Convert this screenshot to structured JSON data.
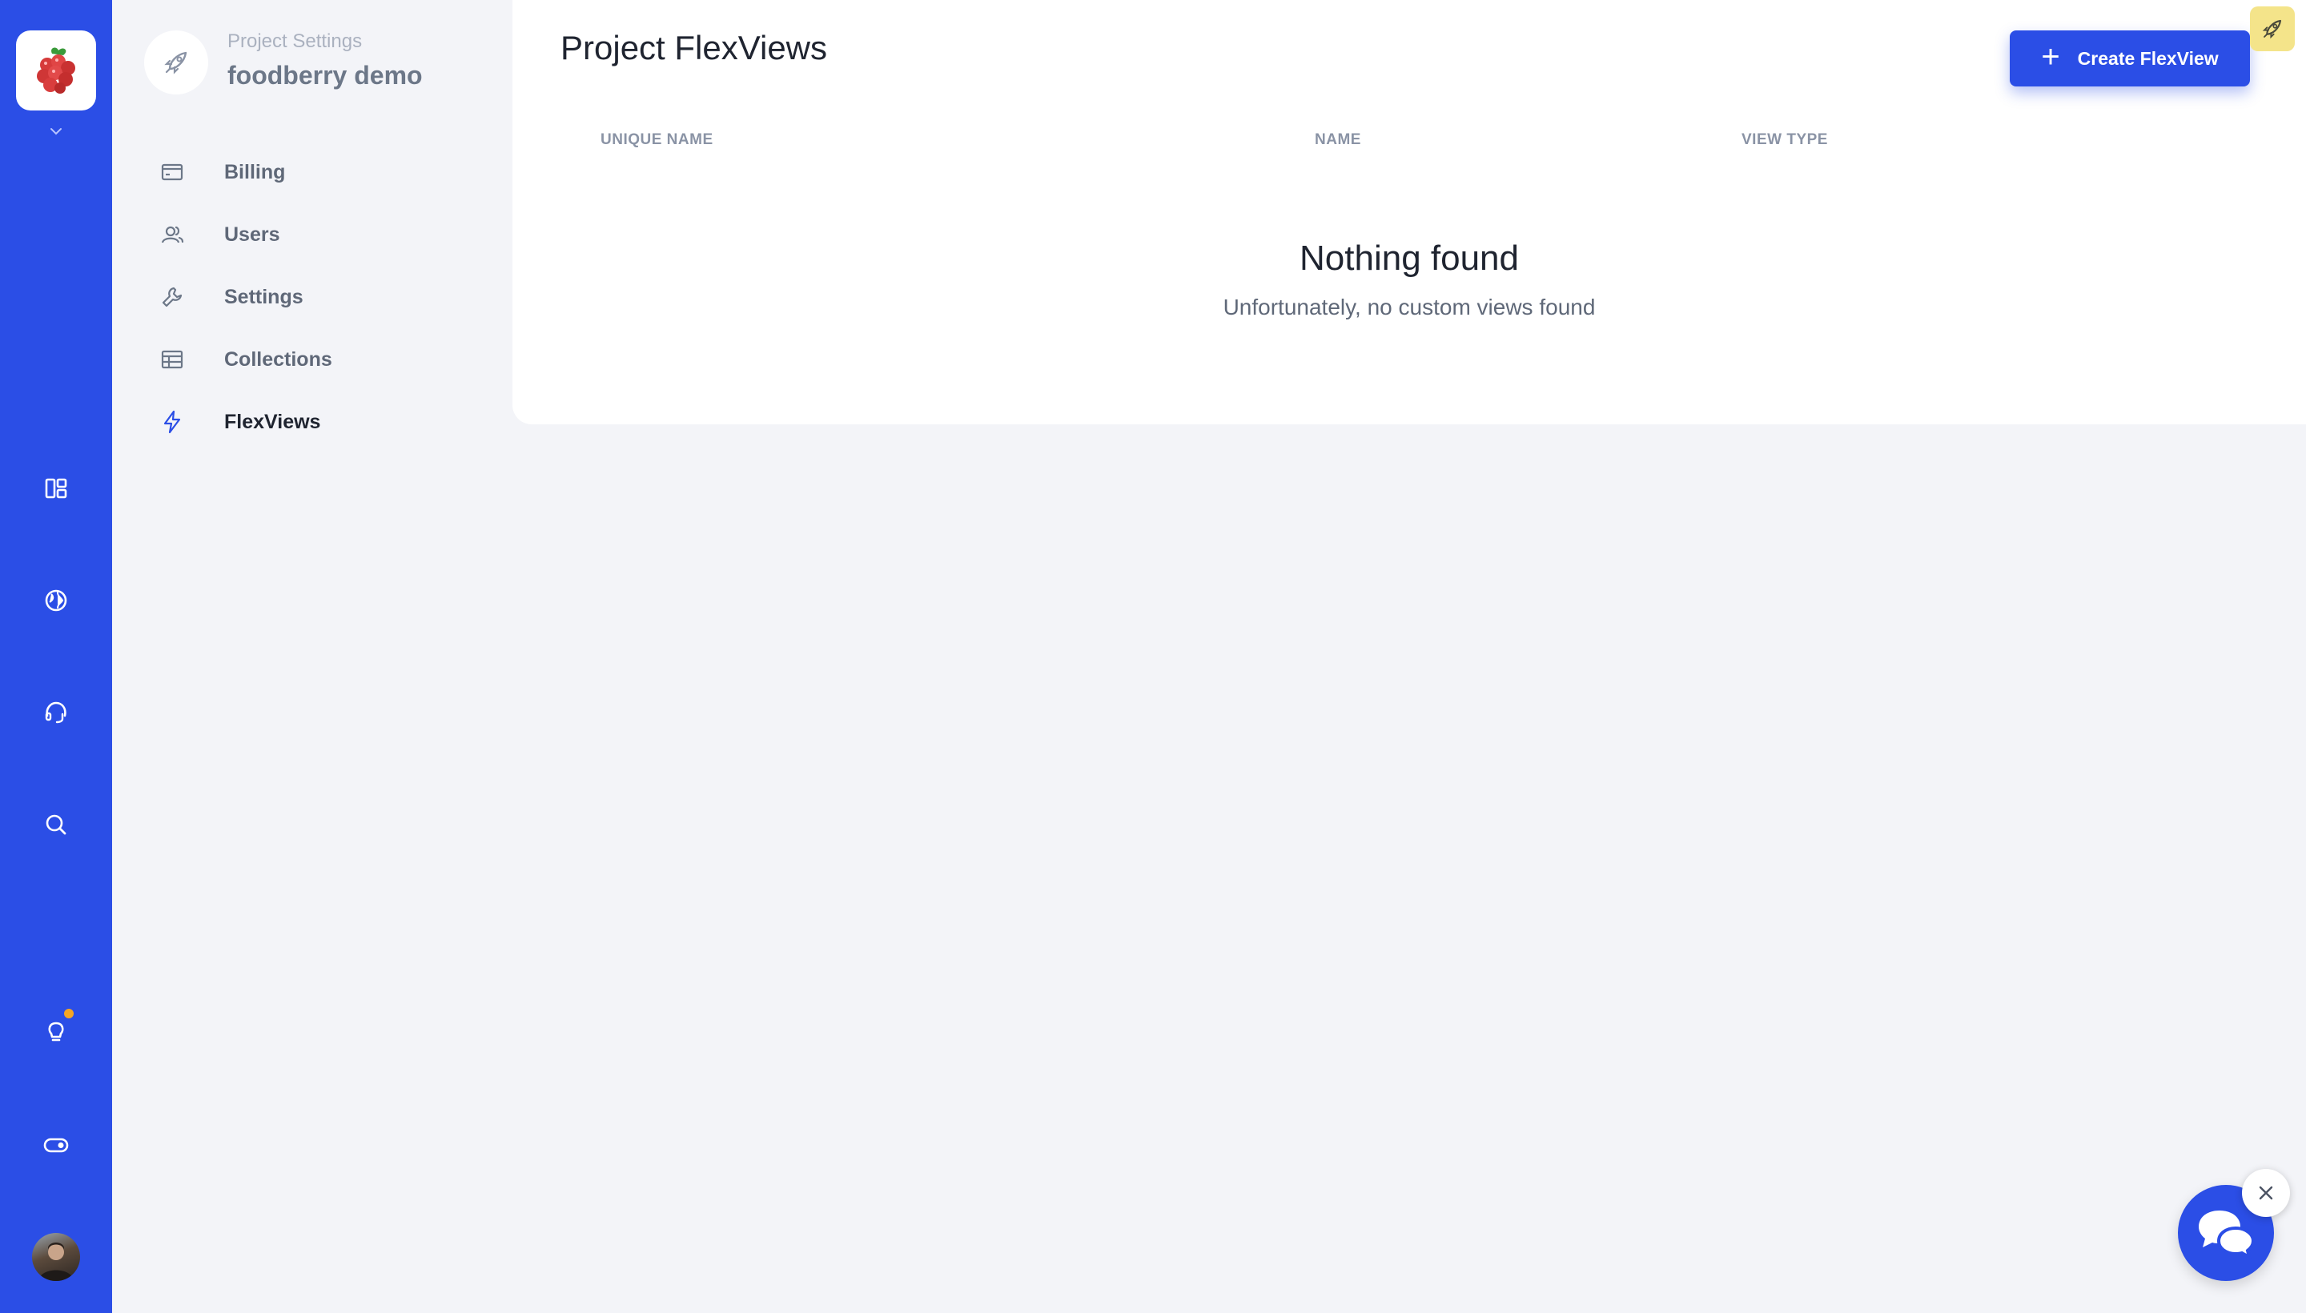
{
  "rail": {
    "logo_icon": "raspberry-logo",
    "icons": [
      "dashboard-icon",
      "globe-icon",
      "headset-icon",
      "search-icon",
      "lightbulb-icon",
      "toggle-icon"
    ],
    "colors": {
      "rail_bg": "#2b4ee6",
      "notification_dot": "#f5a623"
    }
  },
  "sidebar": {
    "kicker": "Project Settings",
    "project_name": "foodberry demo",
    "items": [
      {
        "label": "Billing",
        "icon": "credit-card-icon"
      },
      {
        "label": "Users",
        "icon": "users-icon"
      },
      {
        "label": "Settings",
        "icon": "wrench-icon"
      },
      {
        "label": "Collections",
        "icon": "table-icon"
      },
      {
        "label": "FlexViews",
        "icon": "lightning-icon",
        "active": true
      }
    ]
  },
  "main": {
    "title": "Project FlexViews",
    "create_button_label": "Create FlexView",
    "columns": [
      "UNIQUE NAME",
      "NAME",
      "VIEW TYPE"
    ],
    "empty_title": "Nothing found",
    "empty_subtitle": "Unfortunately, no custom views found"
  },
  "colors": {
    "accent": "#2b4ee6",
    "page_bg": "#f3f4f8",
    "rocket_badge": "#f4e48a"
  }
}
